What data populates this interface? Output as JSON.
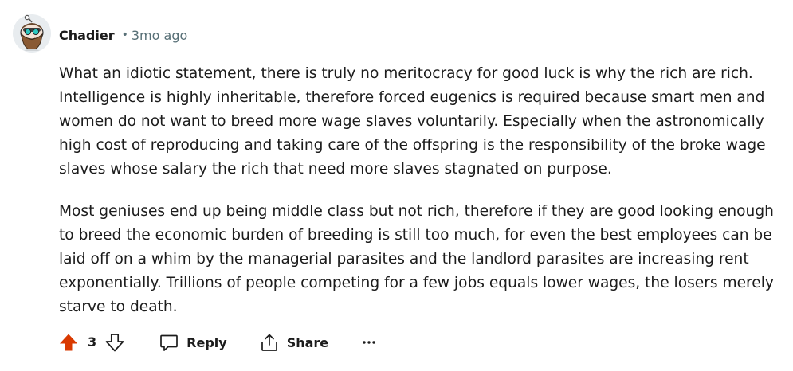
{
  "comment": {
    "author": "Chadier",
    "separator": "•",
    "time_ago": "3mo ago",
    "paragraphs": [
      "What an idiotic statement, there is truly no meritocracy for good luck is why the rich are rich. Intelligence is highly inheritable, therefore forced eugenics is required because smart men and women do not want to breed more wage slaves voluntarily. Especially when the astronomically high cost of reproducing and taking care of the offspring is the responsibility of the broke wage slaves whose salary the rich that need more slaves stagnated on purpose.",
      "Most geniuses end up being middle class but not rich, therefore if they are good looking enough to breed the economic burden of breeding is still too much, for even the best employees can be laid off on a whim by the managerial parasites and the landlord parasites are increasing rent exponentially. Trillions of people competing for a few jobs equals lower wages, the losers merely starve to death."
    ]
  },
  "actions": {
    "score": "3",
    "reply_label": "Reply",
    "share_label": "Share",
    "more_label": "•••"
  },
  "colors": {
    "upvote_active": "#d93900",
    "meta_text": "#576f76",
    "body_text": "#1c1c1c"
  },
  "icons": {
    "avatar": "snoo-avatar-bearded-goggles",
    "upvote": "upvote-arrow-icon",
    "downvote": "downvote-arrow-icon",
    "reply": "speech-bubble-icon",
    "share": "share-icon",
    "more": "ellipsis-icon"
  }
}
